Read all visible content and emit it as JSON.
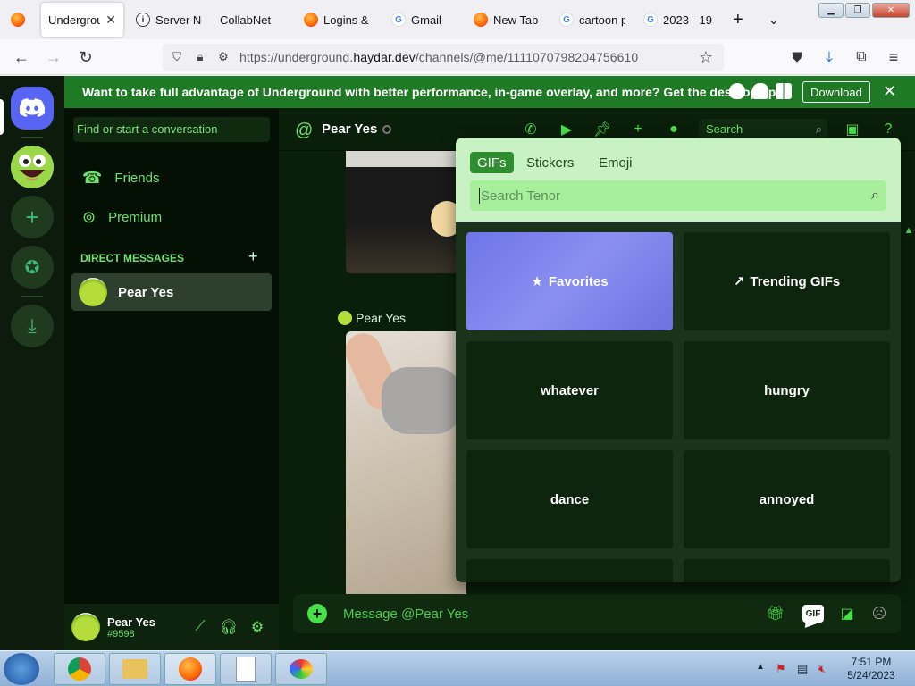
{
  "browser": {
    "tabs": [
      {
        "label": "Undergrou",
        "favicon": "firefox-icon",
        "active": true
      },
      {
        "label": "Server No",
        "favicon": "info-icon"
      },
      {
        "label": "CollabNet",
        "favicon": "none"
      },
      {
        "label": "Logins &",
        "favicon": "firefox-icon"
      },
      {
        "label": "Gmail",
        "favicon": "google-icon"
      },
      {
        "label": "New Tab",
        "favicon": "firefox-icon"
      },
      {
        "label": "cartoon p",
        "favicon": "google-icon"
      },
      {
        "label": "2023 - 19",
        "favicon": "google-icon"
      }
    ],
    "url_prefix": "https://underground.",
    "url_domain": "haydar.dev",
    "url_path": "/channels/@me/1111070798204756610"
  },
  "banner": {
    "text": "Want to take full advantage of Underground with better performance, in-game overlay, and more? Get the desktop app!",
    "download_label": "Download"
  },
  "sidebar": {
    "search_placeholder": "Find or start a conversation",
    "friends_label": "Friends",
    "premium_label": "Premium",
    "dm_header": "DIRECT MESSAGES",
    "dm_items": [
      {
        "name": "Pear Yes"
      }
    ]
  },
  "user": {
    "name": "Pear Yes",
    "tag": "#9598"
  },
  "chat": {
    "title": "Pear Yes",
    "search_placeholder": "Search",
    "message_author": "Pear Yes",
    "composer_placeholder": "Message @Pear Yes",
    "gif_label": "GIF"
  },
  "picker": {
    "tabs": [
      "GIFs",
      "Stickers",
      "Emoji"
    ],
    "active_tab": "GIFs",
    "search_placeholder": "Search Tenor",
    "tiles": [
      {
        "label": "Favorites",
        "icon": "star-icon"
      },
      {
        "label": "Trending GIFs",
        "icon": "trending-icon"
      },
      {
        "label": "whatever"
      },
      {
        "label": "hungry"
      },
      {
        "label": "dance"
      },
      {
        "label": "annoyed"
      }
    ]
  },
  "taskbar": {
    "time": "7:51 PM",
    "date": "5/24/2023"
  },
  "colors": {
    "accent": "#4ade4a",
    "banner": "#1f7a26",
    "blurple": "#5865f2"
  }
}
